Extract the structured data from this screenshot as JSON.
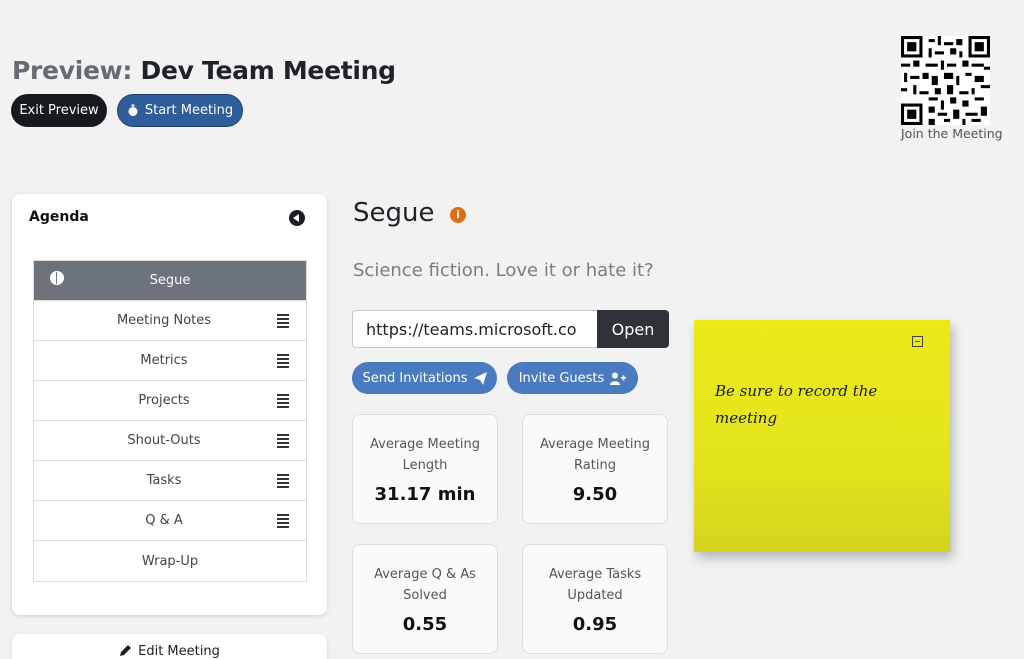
{
  "header": {
    "title_prefix": "Preview:",
    "title_name": "Dev Team Meeting",
    "exit_label": "Exit Preview",
    "start_label": "Start Meeting",
    "qr_label": "Join the Meeting"
  },
  "agenda": {
    "title": "Agenda",
    "items": [
      {
        "label": "Segue",
        "active": true
      },
      {
        "label": "Meeting Notes"
      },
      {
        "label": "Metrics"
      },
      {
        "label": "Projects"
      },
      {
        "label": "Shout-Outs"
      },
      {
        "label": "Tasks"
      },
      {
        "label": "Q & A"
      },
      {
        "label": "Wrap-Up"
      }
    ],
    "edit_label": "Edit Meeting"
  },
  "main": {
    "section_title": "Segue",
    "prompt": "Science fiction. Love it or hate it?",
    "url_value": "https://teams.microsoft.co",
    "open_label": "Open",
    "send_label": "Send Invitations",
    "invite_label": "Invite Guests",
    "metrics": [
      {
        "label": "Average Meeting Length",
        "value": "31.17 min"
      },
      {
        "label": "Average Meeting Rating",
        "value": "9.50"
      },
      {
        "label": "Average Q & As Solved",
        "value": "0.55"
      },
      {
        "label": "Average Tasks Updated",
        "value": "0.95"
      }
    ]
  },
  "sticky_note": {
    "text": "Be sure to record the meeting",
    "color": "#e8e81a"
  },
  "colors": {
    "accent": "#4a7bc0",
    "dark": "#16191d",
    "info": "#e06f14"
  }
}
